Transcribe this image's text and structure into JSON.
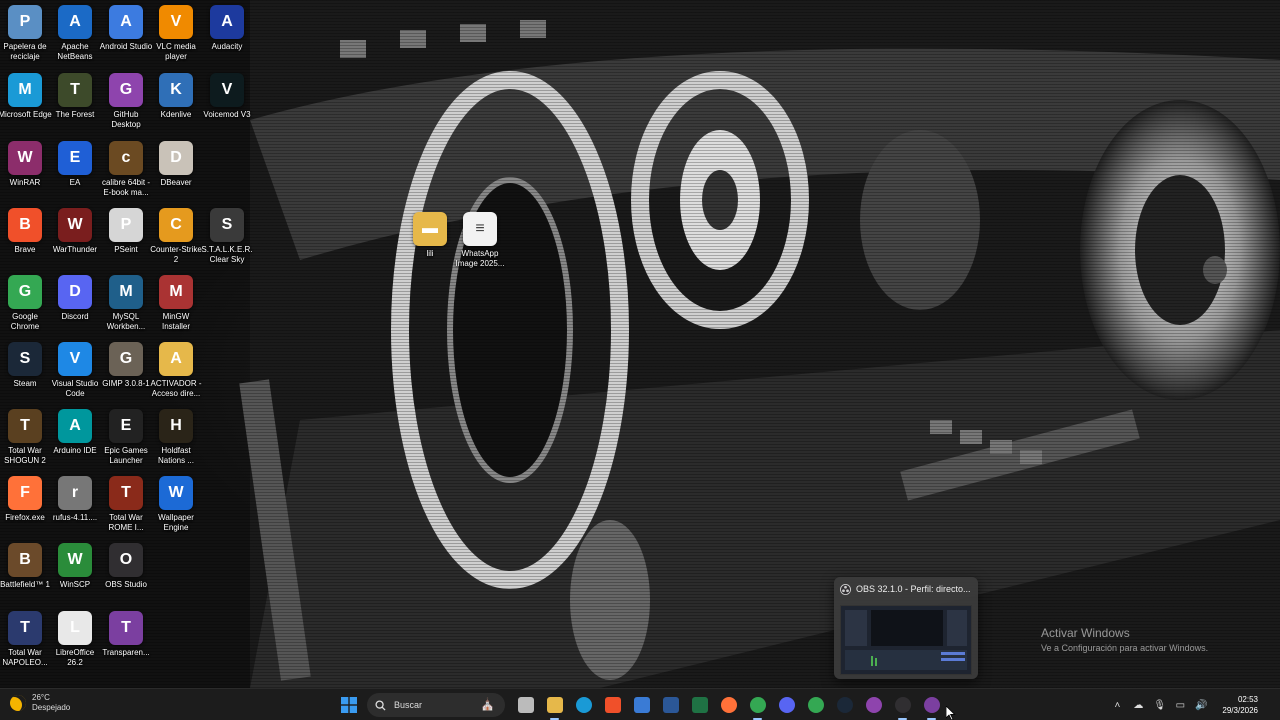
{
  "desktop": {
    "icons": [
      {
        "label": "Papelera de reciclaje",
        "icon": "recycle-bin-icon",
        "color": "#5a8fc4"
      },
      {
        "label": "Apache NetBeans",
        "icon": "netbeans-icon",
        "color": "#1b6ac6"
      },
      {
        "label": "Android Studio",
        "icon": "android-studio-icon",
        "color": "#3c7be0"
      },
      {
        "label": "VLC media player",
        "icon": "vlc-icon",
        "color": "#f08a00"
      },
      {
        "label": "Audacity",
        "icon": "audacity-icon",
        "color": "#1d3a9e"
      },
      {
        "label": "Microsoft Edge",
        "icon": "edge-icon",
        "color": "#1a9ad6"
      },
      {
        "label": "The Forest",
        "icon": "the-forest-icon",
        "color": "#3d4a2a"
      },
      {
        "label": "GitHub Desktop",
        "icon": "github-desktop-icon",
        "color": "#8e44ad"
      },
      {
        "label": "Kdenlive",
        "icon": "kdenlive-icon",
        "color": "#2f6fb7"
      },
      {
        "label": "Voicemod V3",
        "icon": "voicemod-icon",
        "color": "#0d1b1e"
      },
      {
        "label": "WinRAR",
        "icon": "winrar-icon",
        "color": "#8c2d6b"
      },
      {
        "label": "EA",
        "icon": "ea-icon",
        "color": "#1f5fd6"
      },
      {
        "label": "calibre 64bit - E-book ma...",
        "icon": "calibre-icon",
        "color": "#6b4a22"
      },
      {
        "label": "DBeaver",
        "icon": "dbeaver-icon",
        "color": "#c9c2b8"
      },
      {
        "label": "Brave",
        "icon": "brave-icon",
        "color": "#f0502a"
      },
      {
        "label": "WarThunder",
        "icon": "warthunder-icon",
        "color": "#7a1e1e"
      },
      {
        "label": "PSeint",
        "icon": "pseint-icon",
        "color": "#d6d6d6"
      },
      {
        "label": "Counter-Strike 2",
        "icon": "counter-strike-icon",
        "color": "#e59a1e"
      },
      {
        "label": "S.T.A.L.K.E.R. Clear Sky",
        "icon": "stalker-icon",
        "color": "#3a3a3a"
      },
      {
        "label": "Google Chrome",
        "icon": "chrome-icon",
        "color": "#34a853"
      },
      {
        "label": "Discord",
        "icon": "discord-icon",
        "color": "#5865f2"
      },
      {
        "label": "MySQL Workben...",
        "icon": "mysql-workbench-icon",
        "color": "#1f5f8a"
      },
      {
        "label": "MinGW Installer",
        "icon": "mingw-icon",
        "color": "#a33"
      },
      {
        "label": "Steam",
        "icon": "steam-icon",
        "color": "#1b2838"
      },
      {
        "label": "Visual Studio Code",
        "icon": "vscode-icon",
        "color": "#1e88e5"
      },
      {
        "label": "GIMP 3.0.8-1",
        "icon": "gimp-icon",
        "color": "#6b6256"
      },
      {
        "label": "ACTIVADOR - Acceso dire...",
        "icon": "folder-icon",
        "color": "#e6b84a"
      },
      {
        "label": "Total War SHOGUN 2",
        "icon": "shogun2-icon",
        "color": "#5a4020"
      },
      {
        "label": "Arduino IDE",
        "icon": "arduino-icon",
        "color": "#00979d"
      },
      {
        "label": "Epic Games Launcher",
        "icon": "epic-games-icon",
        "color": "#222"
      },
      {
        "label": "Holdfast Nations ...",
        "icon": "holdfast-icon",
        "color": "#2a2418"
      },
      {
        "label": "Firefox.exe",
        "icon": "firefox-icon",
        "color": "#ff7139"
      },
      {
        "label": "rufus-4.11....",
        "icon": "rufus-icon",
        "color": "#777"
      },
      {
        "label": "Total War ROME I...",
        "icon": "rome-icon",
        "color": "#8a2a1a"
      },
      {
        "label": "Wallpaper Engine",
        "icon": "wallpaper-engine-icon",
        "color": "#1c6ad6"
      },
      {
        "label": "Battlefield™ 1",
        "icon": "battlefield-icon",
        "color": "#6b4a2a"
      },
      {
        "label": "WinSCP",
        "icon": "winscp-icon",
        "color": "#2a8c3a"
      },
      {
        "label": "OBS Studio",
        "icon": "obs-icon",
        "color": "#302e31"
      },
      {
        "label": "Total War NAPOLEO...",
        "icon": "napoleon-icon",
        "color": "#2b3a6e"
      },
      {
        "label": "LibreOffice 26.2",
        "icon": "libreoffice-icon",
        "color": "#e8e8e8"
      },
      {
        "label": "Transparen...",
        "icon": "transparent-icon",
        "color": "#7b3fa0"
      }
    ],
    "loose_icons": [
      {
        "label": "lili",
        "icon": "folder-icon",
        "color": "#e6b84a"
      },
      {
        "label": "WhatsApp Image 2025...",
        "icon": "image-file-icon",
        "color": "#f2f2f2"
      }
    ]
  },
  "obs_preview": {
    "title": "OBS 32.1.0 - Perfil: directo...",
    "icon": "obs-icon"
  },
  "activation": {
    "title": "Activar Windows",
    "subtitle": "Ve a Configuración para activar Windows."
  },
  "taskbar": {
    "weather_temp": "26°C",
    "weather_desc": "Despejado",
    "search_label": "Buscar",
    "apps": [
      {
        "name": "start",
        "icon": "windows-start-icon",
        "color": "#3a9bf0"
      },
      {
        "name": "search",
        "icon": "search-icon"
      },
      {
        "name": "task-view",
        "icon": "task-view-icon",
        "color": "#bbb"
      },
      {
        "name": "file-explorer",
        "icon": "file-explorer-icon",
        "color": "#e6b84a"
      },
      {
        "name": "edge",
        "icon": "edge-icon",
        "color": "#1a9ad6"
      },
      {
        "name": "brave",
        "icon": "brave-icon",
        "color": "#f0502a"
      },
      {
        "name": "store",
        "icon": "store-icon",
        "color": "#3a7bd5"
      },
      {
        "name": "word",
        "icon": "word-icon",
        "color": "#2b5797"
      },
      {
        "name": "excel",
        "icon": "excel-icon",
        "color": "#1f7244"
      },
      {
        "name": "firefox",
        "icon": "firefox-icon",
        "color": "#ff7139"
      },
      {
        "name": "chrome",
        "icon": "chrome-icon",
        "color": "#34a853"
      },
      {
        "name": "discord",
        "icon": "discord-icon",
        "color": "#5865f2"
      },
      {
        "name": "chrome-2",
        "icon": "chrome-icon",
        "color": "#34a853"
      },
      {
        "name": "steam",
        "icon": "steam-icon",
        "color": "#1b2838"
      },
      {
        "name": "github-desktop",
        "icon": "github-desktop-icon",
        "color": "#8e44ad"
      },
      {
        "name": "obs",
        "icon": "obs-icon",
        "color": "#302e31"
      },
      {
        "name": "transparent",
        "icon": "transparent-icon",
        "color": "#7b3fa0"
      }
    ],
    "time": "02:53",
    "date": "29/3/2026"
  }
}
